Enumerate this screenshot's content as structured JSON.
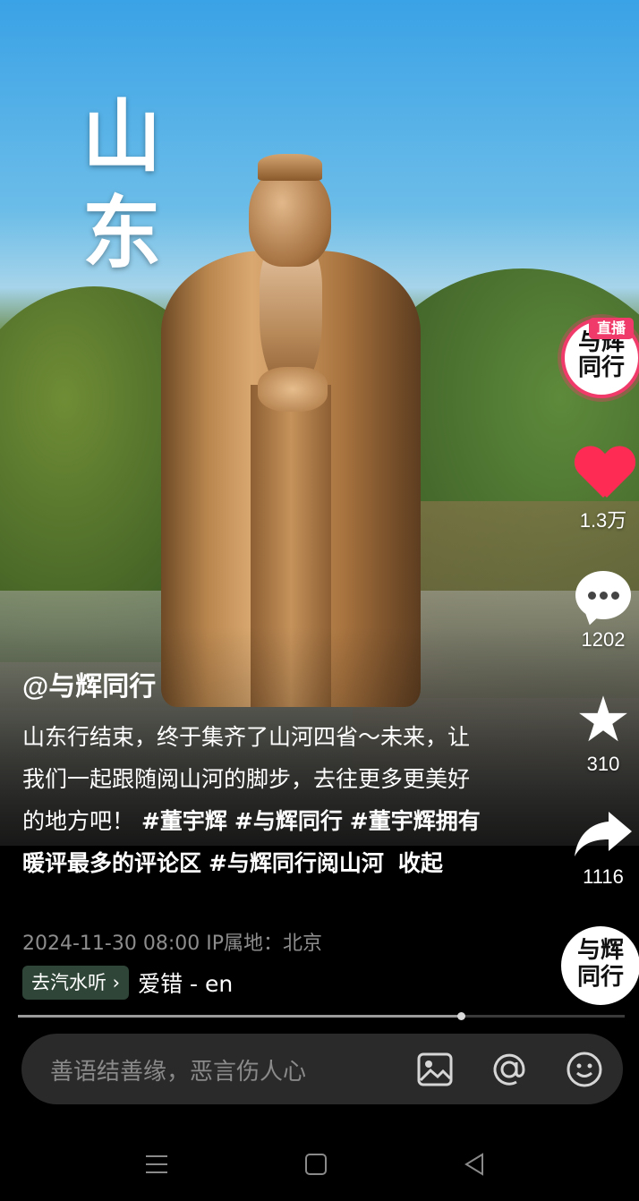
{
  "video": {
    "overlay_title": [
      "山",
      "东"
    ]
  },
  "right_rail": {
    "live_badge": "直播",
    "logo_lines": [
      "与辉",
      "同行"
    ],
    "like_count": "1.3万",
    "comment_count": "1202",
    "favorite_count": "310",
    "share_count": "1116",
    "icons": [
      "avatar-live-icon",
      "heart-icon",
      "comment-icon",
      "star-icon",
      "share-icon",
      "music-disc-icon"
    ],
    "accent_color": "#fe2c55"
  },
  "post": {
    "author": "@与辉同行",
    "caption_text": "山东行结束，终于集齐了山河四省～未来，让我们一起跟随阅山河的脚步，去往更多更美好的地方吧！",
    "hashtags": [
      "#董宇辉",
      "#与辉同行",
      "#董宇辉拥有暖评最多的评论区",
      "#与辉同行阅山河"
    ],
    "collapse_label": "收起",
    "timestamp": "2024-11-30 08:00",
    "location": "IP属地：北京",
    "music_chip": "去汽水听",
    "music_song": "爱错 - en"
  },
  "playback": {
    "progress": 0.73
  },
  "comment_bar": {
    "placeholder": "善语结善缘，恶言伤人心",
    "icons": [
      "image-icon",
      "at-icon",
      "emoji-icon"
    ]
  },
  "system_nav": {
    "icons": [
      "menu-icon",
      "home-icon",
      "back-icon"
    ]
  }
}
